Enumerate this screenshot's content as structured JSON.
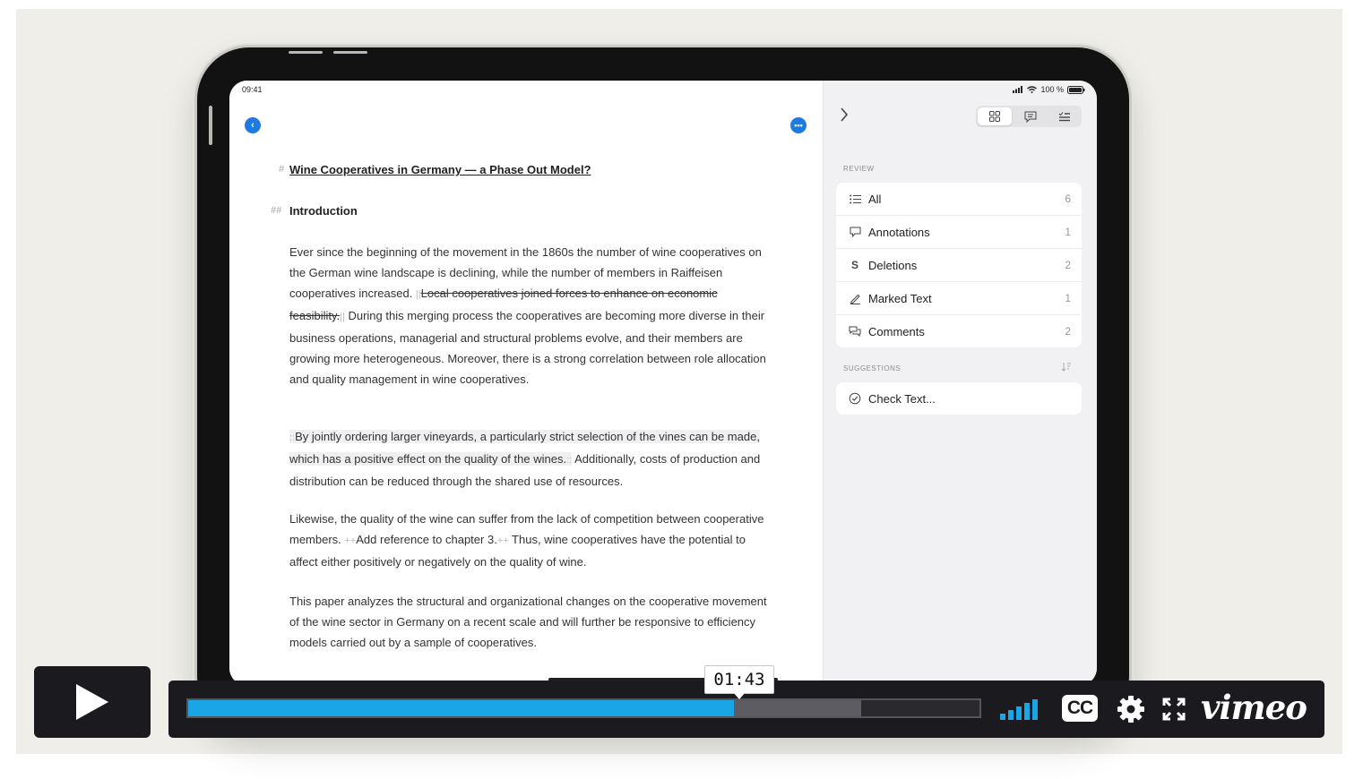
{
  "status": {
    "time": "09:41",
    "battery": "100 %"
  },
  "document": {
    "h1_marker": "#",
    "title": "Wine Cooperatives in Germany — a Phase Out Model?",
    "h2_marker": "##",
    "intro_heading": "Introduction",
    "p1_a": "Ever since the beginning of the movement in the 1860s the number of wine cooperatives on the German wine landscape is declining, while the number of members in Raiffeisen cooperatives increased. ",
    "deletion_marker": "||",
    "p1_deleted": "Local cooperatives joined forces to enhance on economic feasibility.",
    "p1_b": " During this merging process the cooperatives are becoming more diverse in their business operations, managerial and structural problems evolve, and their members are growing more heterogeneous. Moreover, there is a strong correlation between role allocation and quality management in wine cooperatives.",
    "mark_marker": "::",
    "p2_marked": "By jointly ordering larger vineyards, a particularly strict selection of the vines can be made, which has a positive effect on the quality of the wines.",
    "p2_rest": " Additionally, costs of production and distribution can be reduced through the shared use of resources.",
    "p3_a": "Likewise, the quality of the wine can suffer from the lack of competition between cooperative members. ",
    "comment_marker": "++",
    "p3_comment": "Add reference to chapter 3.",
    "p3_b": " Thus, wine cooperatives have the potential to affect either positively or negatively on the quality of wine.",
    "p4": "This paper analyzes the structural and organizational changes on the cooperative movement of the wine sector in Germany on a recent scale and will further be responsive to efficiency models carried out by a sample of cooperatives."
  },
  "sidebar": {
    "review_label": "REVIEW",
    "review_items": [
      {
        "label": "All",
        "count": "6",
        "icon": "list-icon"
      },
      {
        "label": "Annotations",
        "count": "1",
        "icon": "annotation-icon"
      },
      {
        "label": "Deletions",
        "count": "2",
        "icon": "strikethrough-icon"
      },
      {
        "label": "Marked Text",
        "count": "1",
        "icon": "pencil-icon"
      },
      {
        "label": "Comments",
        "count": "2",
        "icon": "comments-icon"
      }
    ],
    "suggestions_label": "SUGGESTIONS",
    "check_text": "Check Text..."
  },
  "player": {
    "tooltip_time": "01:43",
    "progress_fraction": 0.69,
    "buffered_fraction": 0.85,
    "brand": "vimeo",
    "cc": "CC"
  },
  "colors": {
    "accent": "#1f7ae0",
    "progress": "#1aa6e6",
    "player_bg": "#1b1b1f"
  }
}
